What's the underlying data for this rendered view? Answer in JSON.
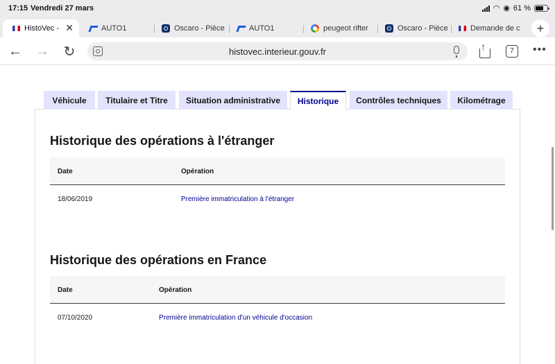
{
  "status_bar": {
    "time": "17:15",
    "date": "Vendredi 27 mars",
    "battery": "61 %"
  },
  "browser_tabs": [
    {
      "label": "HistoVec -",
      "favicon": "french-flag"
    },
    {
      "label": "AUTO1",
      "favicon": "auto1"
    },
    {
      "label": "Oscaro - Pièce",
      "favicon": "oscaro"
    },
    {
      "label": "AUTO1",
      "favicon": "auto1"
    },
    {
      "label": "peugeot rifter",
      "favicon": "google"
    },
    {
      "label": "Oscaro - Pièce",
      "favicon": "oscaro"
    },
    {
      "label": "Demande de c",
      "favicon": "french-flag"
    }
  ],
  "toolbar": {
    "url": "histovec.interieur.gouv.fr",
    "tab_count": "7"
  },
  "page_tabs": [
    {
      "label": "Véhicule"
    },
    {
      "label": "Titulaire et Titre"
    },
    {
      "label": "Situation administrative"
    },
    {
      "label": "Historique"
    },
    {
      "label": "Contrôles techniques"
    },
    {
      "label": "Kilométrage"
    }
  ],
  "active_tab_index": 3,
  "colors": {
    "accent": "#000091",
    "tab_bg": "#e3e3fd",
    "table_header_bg": "#f6f6f6"
  },
  "sections": [
    {
      "title": "Historique des opérations à l'étranger",
      "headers": {
        "date": "Date",
        "operation": "Opération"
      },
      "rows": [
        {
          "date": "18/06/2019",
          "operation": "Première immatriculation à l'étranger"
        }
      ]
    },
    {
      "title": "Historique des opérations en France",
      "headers": {
        "date": "Date",
        "operation": "Opération"
      },
      "rows": [
        {
          "date": "07/10/2020",
          "operation": "Première immatriculation d'un véhicule d'occasion"
        }
      ]
    }
  ]
}
